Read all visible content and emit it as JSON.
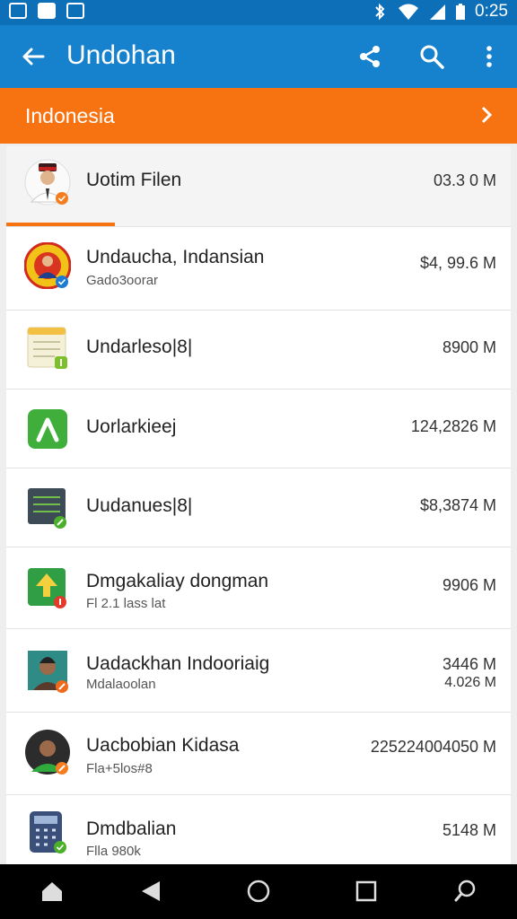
{
  "status": {
    "time": "0:25",
    "icons": [
      "gallery-icon",
      "image-icon",
      "notification-icon",
      "bluetooth-icon",
      "wifi-icon",
      "signal-icon",
      "battery-icon"
    ]
  },
  "appbar": {
    "title": "Undohan",
    "actions": [
      "share-icon",
      "search-icon",
      "more-icon"
    ]
  },
  "banner": {
    "label": "Indonesia"
  },
  "items": [
    {
      "title": "Uotim Filen",
      "subtitle": "",
      "size": "03.3 0 M",
      "size2": "",
      "icon": "person-avatar",
      "badge": "#f57c1f",
      "progress": 0.21
    },
    {
      "title": "Undaucha, Indansian",
      "subtitle": "Gado3oorar",
      "size": "$4, 99.6 M",
      "size2": "",
      "icon": "emblem-avatar",
      "badge": "#1e7ad3"
    },
    {
      "title": "Undarleso|8|",
      "subtitle": "",
      "size": "8900 M",
      "size2": "",
      "icon": "notes-app",
      "badge": "#7cc02b"
    },
    {
      "title": "Uorlarkieej",
      "subtitle": "",
      "size": "124,2826 M",
      "size2": "",
      "icon": "green-app",
      "badge": ""
    },
    {
      "title": "Uudanues|8|",
      "subtitle": "",
      "size": "$8,3874 M",
      "size2": "",
      "icon": "list-app",
      "badge": "#4caf2a"
    },
    {
      "title": "Dmgakaliay dongman",
      "subtitle": "Fl 2.1 lass lat",
      "size": "9906 M",
      "size2": "",
      "icon": "upload-app",
      "badge": "#e23b2b"
    },
    {
      "title": "Uadackhan Indooriaig",
      "subtitle": "Mdalaoolan",
      "size": "3446 M",
      "size2": "4.026 M",
      "icon": "portrait-photo",
      "badge": "#f06a1c"
    },
    {
      "title": "Uacbobian Kidasa",
      "subtitle": "Fla+5los#8",
      "size": "225224004050 M",
      "size2": "",
      "icon": "man-avatar",
      "badge": "#f57c1f"
    },
    {
      "title": "Dmdbalian",
      "subtitle": "Flla 980k",
      "size": "5148 M",
      "size2": "",
      "icon": "calculator-app",
      "badge": "#4caf2a"
    }
  ],
  "nav": [
    "home-icon",
    "back-icon",
    "recents-home-circle-icon",
    "overview-square-icon",
    "assist-icon"
  ]
}
